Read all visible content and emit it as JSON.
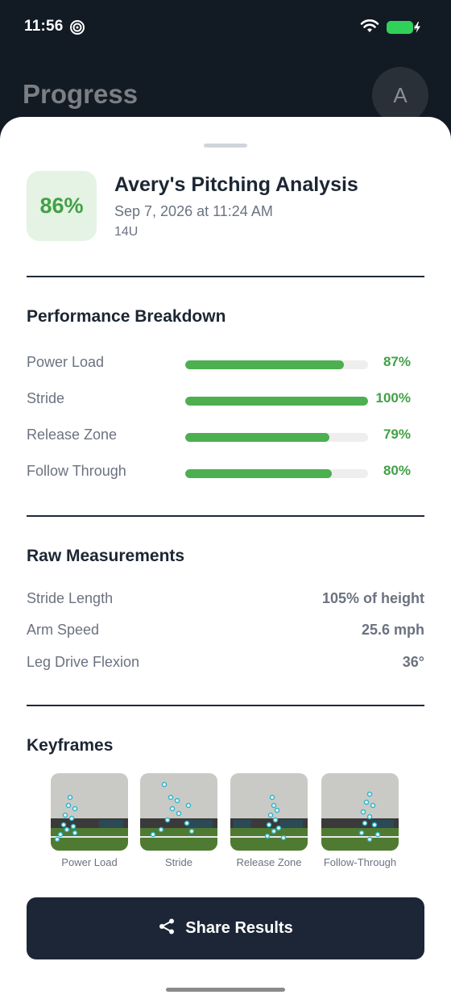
{
  "status_bar": {
    "time": "11:56",
    "location_icon": "location-services-icon",
    "wifi_icon": "wifi-icon",
    "battery_icon": "battery-charging-icon",
    "battery_color": "#30d158"
  },
  "background": {
    "title": "Progress",
    "avatar_initial": "A"
  },
  "sheet": {
    "score": "86%",
    "title": "Avery's Pitching Analysis",
    "date": "Sep 7, 2026 at 11:24 AM",
    "age_group": "14U"
  },
  "performance": {
    "heading": "Performance Breakdown",
    "items": [
      {
        "label": "Power Load",
        "value": "87%",
        "fraction": 0.87
      },
      {
        "label": "Stride",
        "value": "100%",
        "fraction": 1.0
      },
      {
        "label": "Release Zone",
        "value": "79%",
        "fraction": 0.79
      },
      {
        "label": "Follow Through",
        "value": "80%",
        "fraction": 0.8
      }
    ]
  },
  "raw": {
    "heading": "Raw Measurements",
    "items": [
      {
        "label": "Stride Length",
        "value": "105% of height"
      },
      {
        "label": "Arm Speed",
        "value": "25.6 mph"
      },
      {
        "label": "Leg Drive Flexion",
        "value": "36°"
      }
    ]
  },
  "keyframes": {
    "heading": "Keyframes",
    "items": [
      {
        "label": "Power Load"
      },
      {
        "label": "Stride"
      },
      {
        "label": "Release Zone"
      },
      {
        "label": "Follow-Through"
      }
    ]
  },
  "share": {
    "label": "Share Results",
    "icon": "share-icon"
  },
  "colors": {
    "accent_green": "#4caf50",
    "button_dark": "#1c2636",
    "background_dark": "#121a24"
  }
}
